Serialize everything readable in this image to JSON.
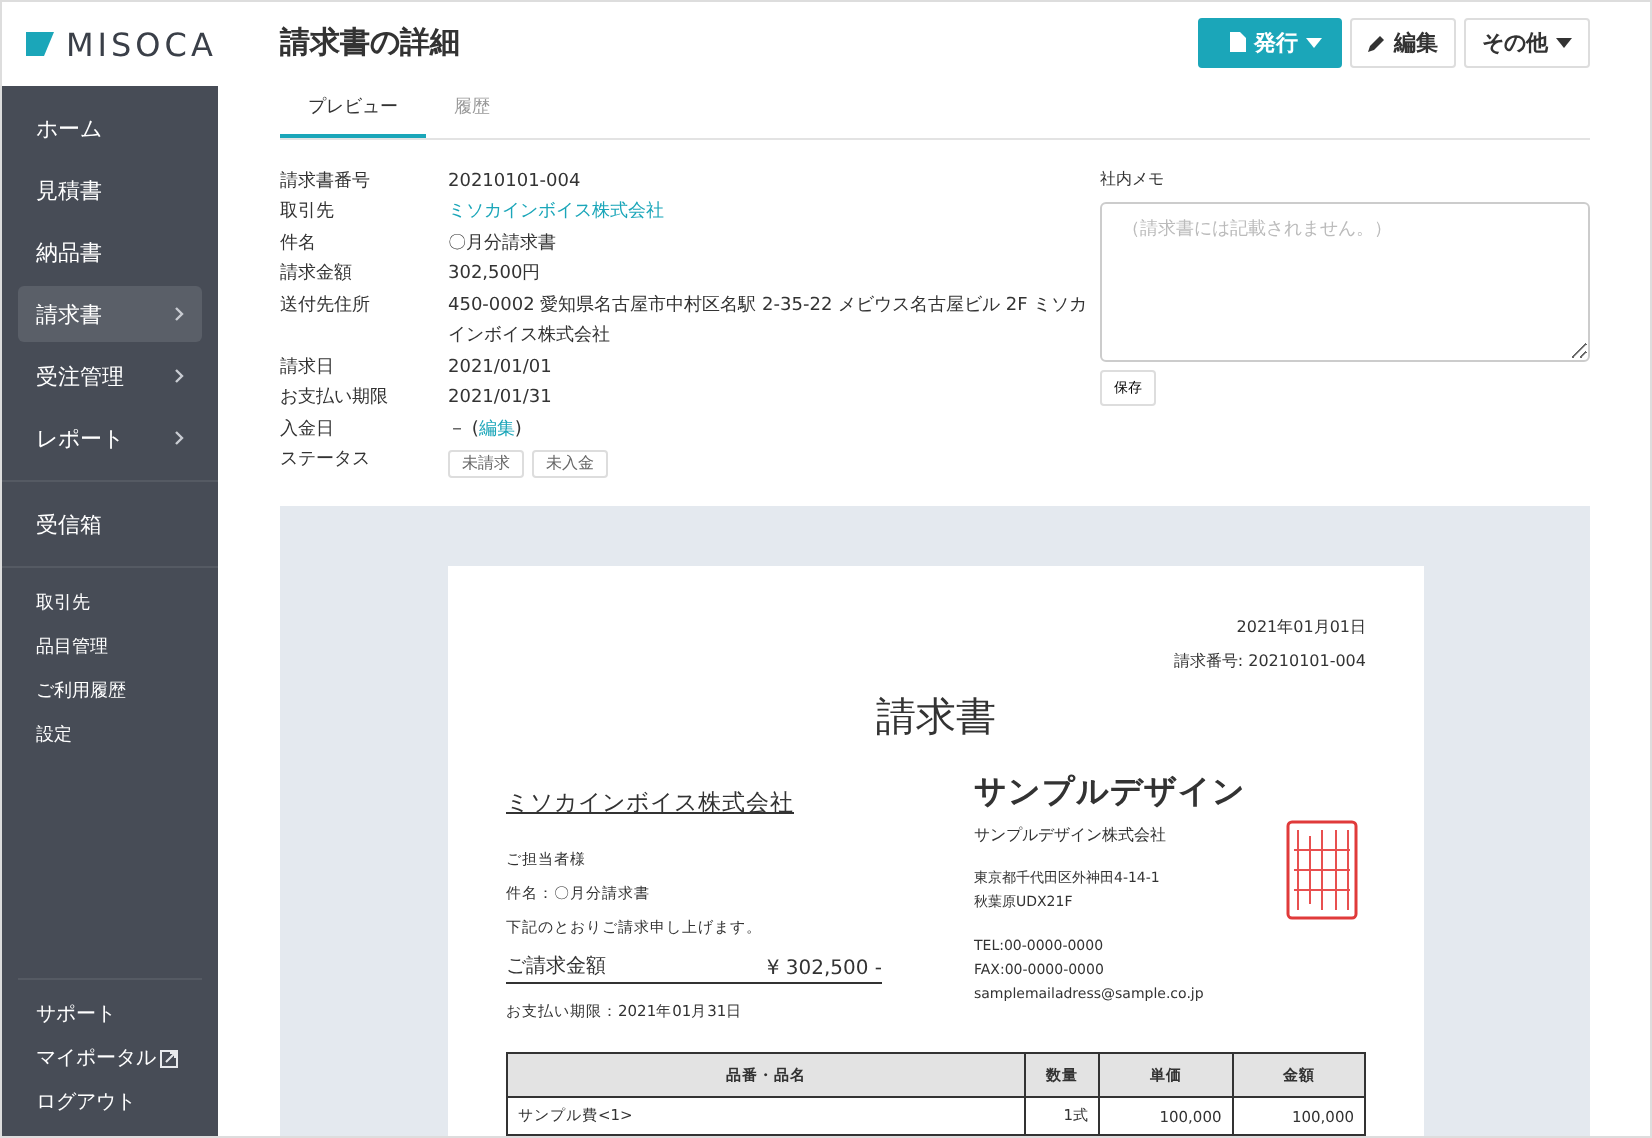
{
  "sidebar": {
    "logo": "MISOCA",
    "groups": [
      [
        {
          "label": "ホーム",
          "selected": false,
          "submenu": false
        },
        {
          "label": "見積書",
          "selected": false,
          "submenu": false
        },
        {
          "label": "納品書",
          "selected": false,
          "submenu": false
        },
        {
          "label": "請求書",
          "selected": true,
          "submenu": true
        },
        {
          "label": "受注管理",
          "selected": false,
          "submenu": true
        },
        {
          "label": "レポート",
          "selected": false,
          "submenu": true
        }
      ],
      [
        {
          "label": "受信箱",
          "selected": false,
          "submenu": false
        }
      ]
    ],
    "secondary": [
      "取引先",
      "品目管理",
      "ご利用履歴",
      "設定"
    ],
    "footer": [
      {
        "label": "サポート",
        "external": false
      },
      {
        "label": "マイポータル",
        "external": true
      },
      {
        "label": "ログアウト",
        "external": false
      }
    ]
  },
  "header": {
    "title": "請求書の詳細",
    "buttons": [
      {
        "label": "発行",
        "kind": "primary"
      },
      {
        "label": "編集",
        "kind": "edit"
      },
      {
        "label": "その他",
        "kind": "dropdown"
      }
    ]
  },
  "tabs": [
    {
      "label": "プレビュー",
      "selected": true
    },
    {
      "label": "履歴",
      "selected": false
    }
  ],
  "details": [
    {
      "label": "請求書番号",
      "kind": "text",
      "value": "20210101-004"
    },
    {
      "label": "取引先",
      "kind": "link",
      "value": "ミソカインボイス株式会社"
    },
    {
      "label": "件名",
      "kind": "text",
      "value": "〇月分請求書"
    },
    {
      "label": "請求金額",
      "kind": "text",
      "value": "302,500円"
    },
    {
      "label": "送付先住所",
      "kind": "text",
      "value": "450-0002 愛知県名古屋市中村区名駅 2-35-22 メビウス名古屋ビル 2F ミソカインボイス株式会社"
    },
    {
      "label": "請求日",
      "kind": "text",
      "value": "2021/01/01"
    },
    {
      "label": "お支払い期限",
      "kind": "text",
      "value": "2021/01/31"
    },
    {
      "label": "入金日",
      "kind": "edit",
      "prefix": "－ (",
      "link": "編集",
      "suffix": ")"
    },
    {
      "label": "ステータス",
      "kind": "badges",
      "badges": [
        "未請求",
        "未入金"
      ]
    }
  ],
  "memo": {
    "label": "社内メモ",
    "placeholder": "（請求書には記載されません。）",
    "save": "保存"
  },
  "invoice": {
    "date": "2021年01月01日",
    "number": "請求番号: 20210101-004",
    "title": "請求書",
    "recipient": "ミソカインボイス株式会社",
    "attention": "ご担当者様",
    "subject": "件名：〇月分請求書",
    "message": "下記のとおりご請求申し上げます。",
    "amount_label": "ご請求金額",
    "amount": "¥ 302,500 -",
    "due": "お支払い期限：2021年01月31日",
    "brand": "サンプルデザイン",
    "company": "サンプルデザイン株式会社",
    "address": [
      "東京都千代田区外神田4-14-1",
      "秋葉原UDX21F"
    ],
    "contact": [
      "TEL:00-0000-0000",
      "FAX:00-0000-0000",
      "samplemailadress@sample.co.jp"
    ],
    "columns": [
      "品番・品名",
      "数量",
      "単価",
      "金額"
    ],
    "rows": [
      [
        "サンプル費<1>",
        "1式",
        "100,000",
        "100,000"
      ]
    ]
  }
}
